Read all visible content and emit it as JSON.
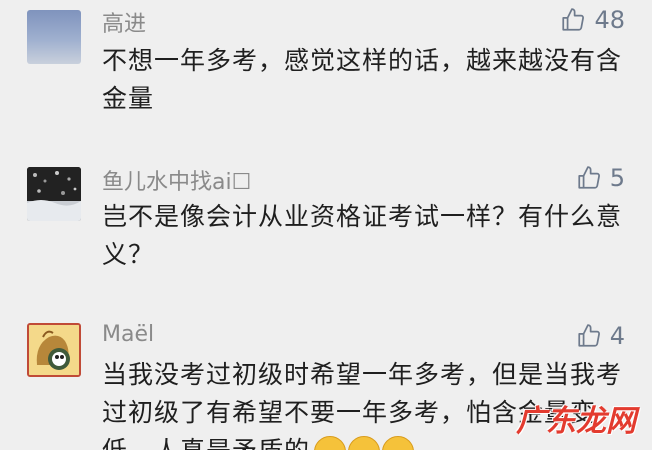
{
  "comments": [
    {
      "author": "高进",
      "likes": "48",
      "text": "不想一年多考，感觉这样的话，越来越没有含金量",
      "avatar_icon": "sky-gradient-avatar"
    },
    {
      "author": "鱼儿水中找ai☐",
      "likes": "5",
      "text": "岂不是像会计从业资格证考试一样？有什么意义？",
      "avatar_icon": "snow-scene-avatar"
    },
    {
      "author": "Maël",
      "likes": "4",
      "text": "当我没考过初级时希望一年多考，但是当我考过初级了有希望不要一年多考，怕含金量变低，人真是矛盾的",
      "avatar_icon": "cartoon-character-avatar",
      "emoji_icon": "laughing-crying-emoji"
    }
  ],
  "watermark": "广东龙网",
  "colors": {
    "background": "#efefef",
    "name": "#8a8a8a",
    "like": "#6e7a8c",
    "text": "#1f1f1f",
    "watermark": "#e33b2f"
  }
}
